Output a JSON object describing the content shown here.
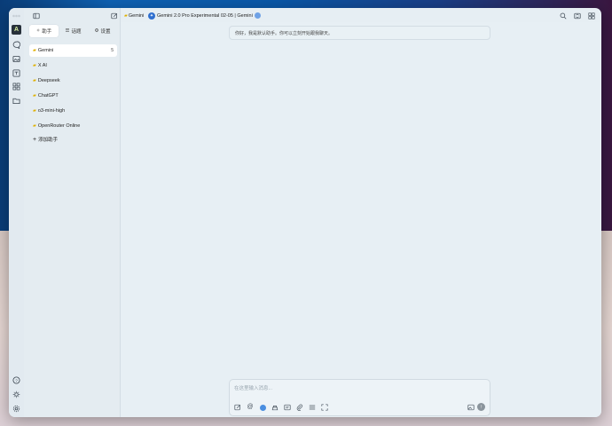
{
  "window": {
    "topbar": {
      "assistant_tab": "Gemini",
      "model_title": "Gemini 2.0 Pro Experimental 02-05 | Gemini"
    }
  },
  "sidebar": {
    "tabs": [
      {
        "label": "助手",
        "icon": "sparkle-icon"
      },
      {
        "label": "话题",
        "icon": "list-icon"
      },
      {
        "label": "设置",
        "icon": "gear-icon"
      }
    ],
    "assistants": [
      {
        "label": "Gemini",
        "count": "5"
      },
      {
        "label": "X AI",
        "count": ""
      },
      {
        "label": "Deepseek",
        "count": ""
      },
      {
        "label": "ChatGPT",
        "count": ""
      },
      {
        "label": "o3-mini-high",
        "count": ""
      },
      {
        "label": "OpenRouter Online",
        "count": ""
      }
    ],
    "add_label": "添加助手"
  },
  "main": {
    "greeting": "你好，我是默认助手。你可以立刻开始跟我聊天。",
    "input_placeholder": "在这里输入消息..."
  },
  "colors": {
    "accent": "#4a8ee0",
    "gemini_badge": "#2f6fcf"
  }
}
